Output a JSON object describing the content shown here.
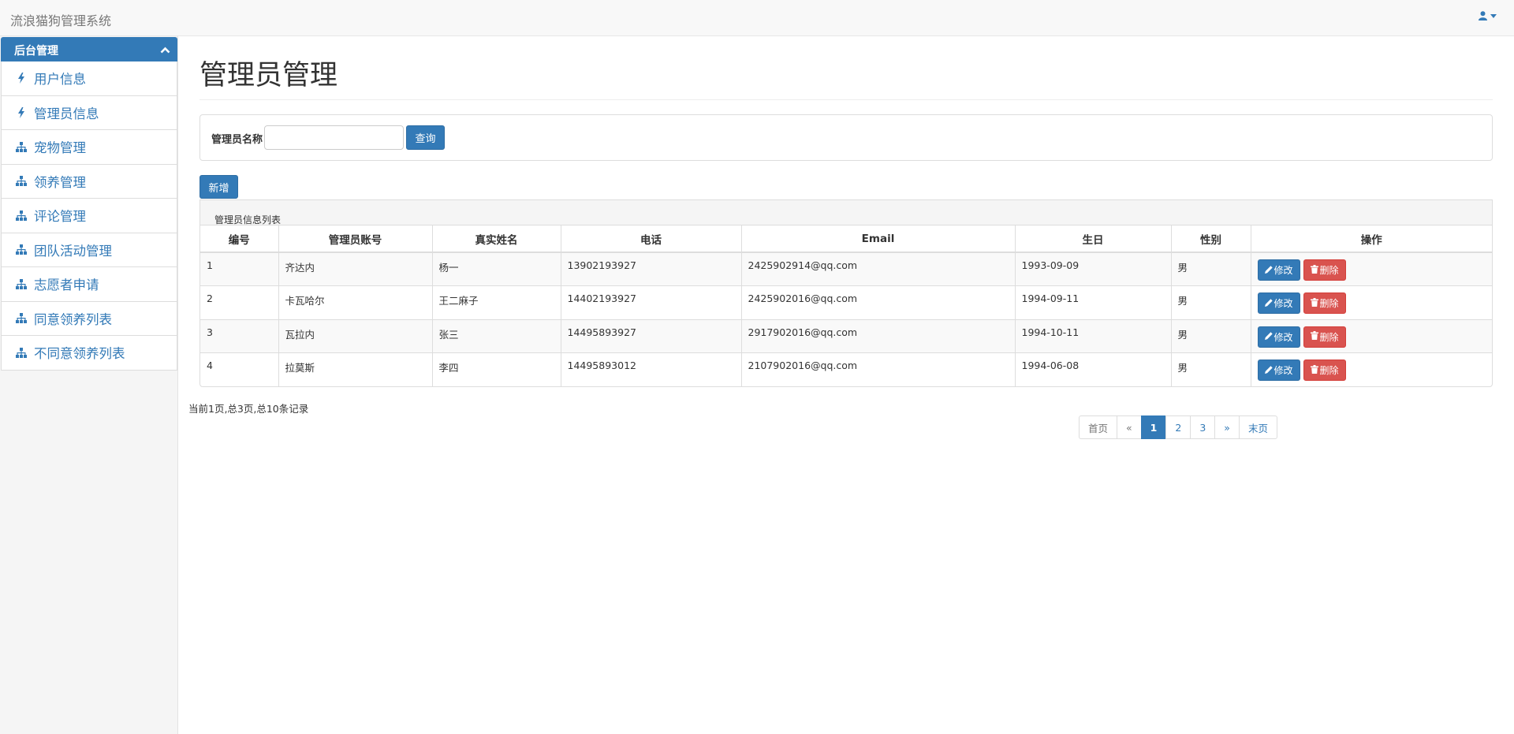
{
  "app": {
    "brand": "流浪猫狗管理系统",
    "user_icon": "user-icon"
  },
  "sidebar": {
    "header": "后台管理",
    "items": [
      {
        "label": "用户信息",
        "icon": "bolt-icon"
      },
      {
        "label": "管理员信息",
        "icon": "bolt-icon"
      },
      {
        "label": "宠物管理",
        "icon": "sitemap-icon"
      },
      {
        "label": "领养管理",
        "icon": "sitemap-icon"
      },
      {
        "label": "评论管理",
        "icon": "sitemap-icon"
      },
      {
        "label": "团队活动管理",
        "icon": "sitemap-icon"
      },
      {
        "label": "志愿者申请",
        "icon": "sitemap-icon"
      },
      {
        "label": "同意领养列表",
        "icon": "sitemap-icon"
      },
      {
        "label": "不同意领养列表",
        "icon": "sitemap-icon"
      }
    ]
  },
  "page": {
    "title": "管理员管理"
  },
  "search": {
    "label": "管理员名称",
    "value": "",
    "button": "查询"
  },
  "actions": {
    "add": "新增"
  },
  "table": {
    "caption": "管理员信息列表",
    "columns": [
      "编号",
      "管理员账号",
      "真实姓名",
      "电话",
      "Email",
      "生日",
      "性别",
      "操作"
    ],
    "rows": [
      {
        "id": "1",
        "account": "齐达内",
        "name": "杨一",
        "phone": "13902193927",
        "email": "2425902914@qq.com",
        "birthday": "1993-09-09",
        "gender": "男"
      },
      {
        "id": "2",
        "account": "卡瓦哈尔",
        "name": "王二麻子",
        "phone": "14402193927",
        "email": "2425902016@qq.com",
        "birthday": "1994-09-11",
        "gender": "男"
      },
      {
        "id": "3",
        "account": "瓦拉内",
        "name": "张三",
        "phone": "14495893927",
        "email": "2917902016@qq.com",
        "birthday": "1994-10-11",
        "gender": "男"
      },
      {
        "id": "4",
        "account": "拉莫斯",
        "name": "李四",
        "phone": "14495893012",
        "email": "2107902016@qq.com",
        "birthday": "1994-06-08",
        "gender": "男"
      }
    ],
    "edit_label": "修改",
    "delete_label": "删除"
  },
  "pagination": {
    "info": "当前1页,总3页,总10条记录",
    "first": "首页",
    "prev": "«",
    "pages": [
      "1",
      "2",
      "3"
    ],
    "active": "1",
    "next": "»",
    "last": "末页"
  }
}
